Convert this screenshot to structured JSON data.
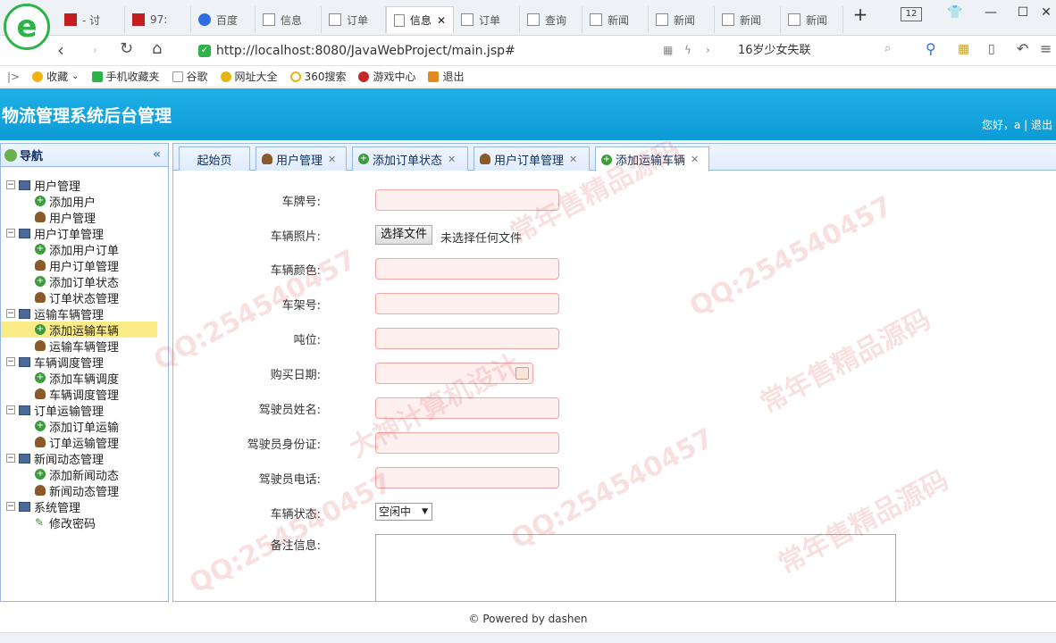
{
  "browser": {
    "tabs": [
      {
        "label": "- 讨"
      },
      {
        "label": "97:"
      },
      {
        "label": "百度"
      },
      {
        "label": "信息"
      },
      {
        "label": "订单"
      },
      {
        "label": "信息"
      },
      {
        "label": "订单"
      },
      {
        "label": "查询"
      },
      {
        "label": "新闻"
      },
      {
        "label": "新闻"
      },
      {
        "label": "新闻"
      },
      {
        "label": "新闻"
      }
    ],
    "new_tab": "+",
    "tab_count": "12",
    "url": "http://localhost:8080/JavaWebProject/main.jsp#",
    "suggestion": "16岁少女失联",
    "bookmarks": [
      "收藏",
      "手机收藏夹",
      "谷歌",
      "网址大全",
      "360搜索",
      "游戏中心",
      "退出"
    ]
  },
  "header": {
    "title": "物流管理系统后台管理",
    "user_text": "您好，a | 退出"
  },
  "sidebar": {
    "title": "导航",
    "groups": [
      {
        "label": "用户管理",
        "items": [
          "添加用户",
          "用户管理"
        ]
      },
      {
        "label": "用户订单管理",
        "items": [
          "添加用户订单",
          "用户订单管理",
          "添加订单状态",
          "订单状态管理"
        ]
      },
      {
        "label": "运输车辆管理",
        "items": [
          "添加运输车辆",
          "运输车辆管理"
        ]
      },
      {
        "label": "车辆调度管理",
        "items": [
          "添加车辆调度",
          "车辆调度管理"
        ]
      },
      {
        "label": "订单运输管理",
        "items": [
          "添加订单运输",
          "订单运输管理"
        ]
      },
      {
        "label": "新闻动态管理",
        "items": [
          "添加新闻动态",
          "新闻动态管理"
        ]
      },
      {
        "label": "系统管理",
        "items": [
          "修改密码"
        ]
      }
    ]
  },
  "content_tabs": [
    "起始页",
    "用户管理",
    "添加订单状态",
    "用户订单管理",
    "添加运输车辆"
  ],
  "form": {
    "plate_label": "车牌号:",
    "photo_label": "车辆照片:",
    "file_button": "选择文件",
    "file_hint": "未选择任何文件",
    "color_label": "车辆颜色:",
    "frame_label": "车架号:",
    "tonnage_label": "吨位:",
    "purchase_date_label": "购买日期:",
    "driver_name_label": "驾驶员姓名:",
    "driver_id_label": "驾驶员身份证:",
    "driver_phone_label": "驾驶员电话:",
    "status_label": "车辆状态:",
    "status_value": "空闲中",
    "remark_label": "备注信息:"
  },
  "footer": "© Powered by dashen",
  "watermarks": [
    "常年售精品源码",
    "QQ:254540457",
    "大神计算机设计"
  ]
}
